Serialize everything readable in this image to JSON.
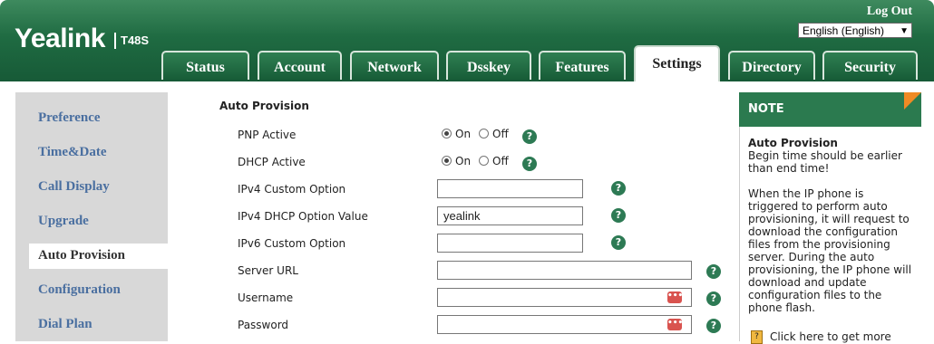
{
  "brand": {
    "logo": "Yealink",
    "model": "T48S"
  },
  "header": {
    "logout": "Log Out",
    "language": "English (English)"
  },
  "tabs": [
    {
      "label": "Status"
    },
    {
      "label": "Account"
    },
    {
      "label": "Network"
    },
    {
      "label": "Dsskey"
    },
    {
      "label": "Features"
    },
    {
      "label": "Settings",
      "active": true
    },
    {
      "label": "Directory"
    },
    {
      "label": "Security"
    }
  ],
  "sidebar": {
    "items": [
      {
        "label": "Preference"
      },
      {
        "label": "Time&Date"
      },
      {
        "label": "Call Display"
      },
      {
        "label": "Upgrade"
      },
      {
        "label": "Auto Provision",
        "active": true
      },
      {
        "label": "Configuration"
      },
      {
        "label": "Dial Plan"
      }
    ]
  },
  "form": {
    "section_title": "Auto Provision",
    "pnp_active": {
      "label": "PNP Active",
      "on": "On",
      "off": "Off",
      "value": "On"
    },
    "dhcp_active": {
      "label": "DHCP Active",
      "on": "On",
      "off": "Off",
      "value": "On"
    },
    "ipv4_custom": {
      "label": "IPv4 Custom Option",
      "value": ""
    },
    "ipv4_dhcp_value": {
      "label": "IPv4 DHCP Option Value",
      "value": "yealink"
    },
    "ipv6_custom": {
      "label": "IPv6 Custom Option",
      "value": ""
    },
    "server_url": {
      "label": "Server URL",
      "value": ""
    },
    "username": {
      "label": "Username",
      "value": ""
    },
    "password": {
      "label": "Password",
      "value": ""
    },
    "help_glyph": "?"
  },
  "note": {
    "title": "NOTE",
    "heading": "Auto Provision",
    "line1": "Begin time should be earlier than end time!",
    "line2": "When the IP phone is triggered to perform auto provisioning, it will request to download the configuration files from the provisioning server. During the auto provisioning, the IP phone will download and update configuration files to the phone flash.",
    "more": "Click here to get more"
  },
  "colors": {
    "header_green": "#1f6b42",
    "accent_orange": "#f08a24",
    "link_blue": "#4a6fa0"
  }
}
